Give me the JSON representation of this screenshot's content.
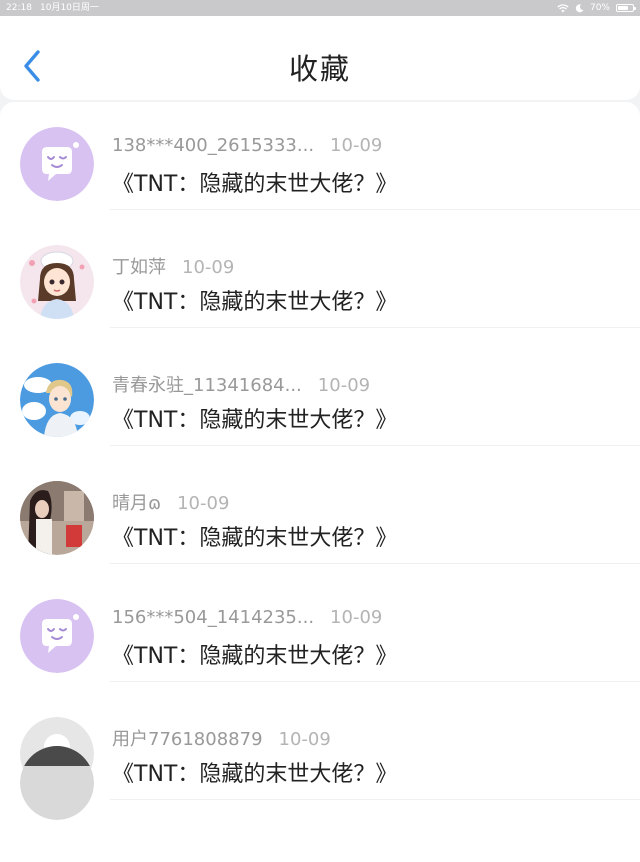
{
  "status_bar": {
    "time": "22:18",
    "date": "10月10日周一",
    "battery": "70%",
    "battery_level": 0.7
  },
  "header": {
    "title": "收藏"
  },
  "items": [
    {
      "user": "138***400_2615333...",
      "date": "10-09",
      "title": "《TNT：隐藏的末世大佬？》",
      "avatar": "chat-bubble-icon"
    },
    {
      "user": "丁如萍",
      "date": "10-09",
      "title": "《TNT：隐藏的末世大佬？》",
      "avatar": "anime-girl-avatar"
    },
    {
      "user": "青春永驻_11341684...",
      "date": "10-09",
      "title": "《TNT：隐藏的末世大佬？》",
      "avatar": "anime-boy-sky-avatar"
    },
    {
      "user": "晴月ɷ",
      "date": "10-09",
      "title": "《TNT：隐藏的末世大佬？》",
      "avatar": "photo-avatar"
    },
    {
      "user": "156***504_1414235...",
      "date": "10-09",
      "title": "《TNT：隐藏的末世大佬？》",
      "avatar": "chat-bubble-icon"
    },
    {
      "user": "用户7761808879",
      "date": "10-09",
      "title": "《TNT：隐藏的末世大佬？》",
      "avatar": "default-user-icon"
    }
  ],
  "colors": {
    "accent": "#3a8ee6",
    "avatar_purple": "#d8c2f2",
    "text_primary": "#222222",
    "text_secondary": "#999999"
  }
}
